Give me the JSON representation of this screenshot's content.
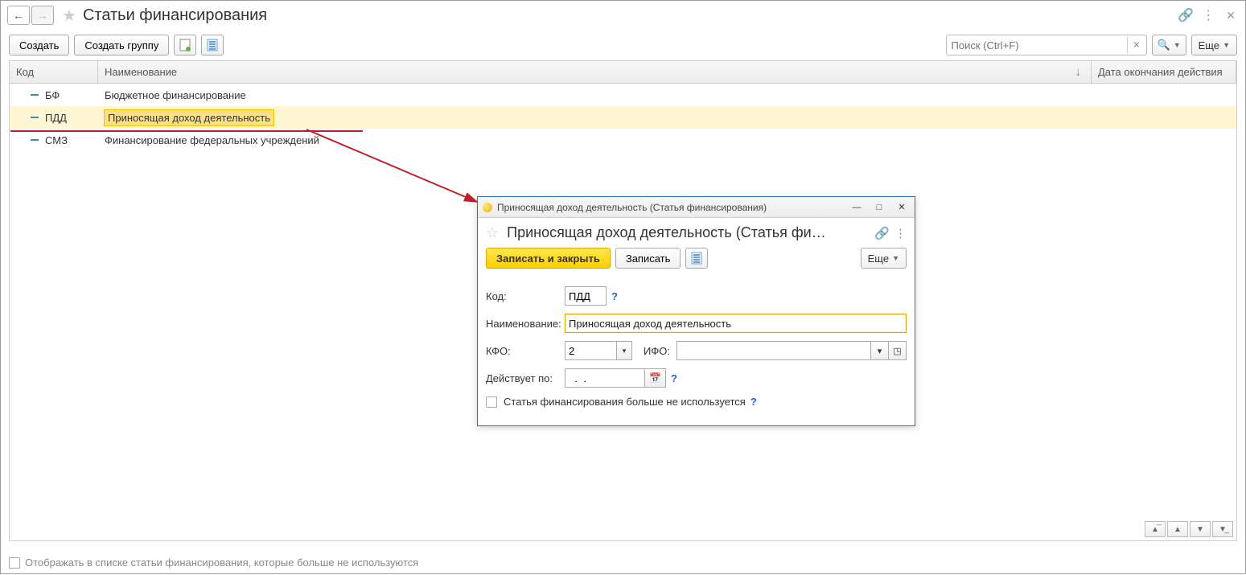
{
  "header": {
    "title": "Статьи финансирования"
  },
  "toolbar": {
    "create": "Создать",
    "create_group": "Создать группу",
    "search_placeholder": "Поиск (Ctrl+F)",
    "more": "Еще"
  },
  "grid": {
    "headers": {
      "code": "Код",
      "name": "Наименование",
      "end_date": "Дата окончания действия"
    },
    "rows": [
      {
        "code": "БФ",
        "name": "Бюджетное финансирование",
        "selected": false
      },
      {
        "code": "ПДД",
        "name": "Приносящая доход деятельность",
        "selected": true
      },
      {
        "code": "СМЗ",
        "name": "Финансирование федеральных учреждений",
        "selected": false
      }
    ]
  },
  "footer": {
    "show_unused": "Отображать в списке статьи финансирования, которые больше не используются"
  },
  "modal": {
    "titlebar": "Приносящая доход деятельность (Статья финансирования)",
    "title": "Приносящая доход деятельность (Статья фи…",
    "save_close": "Записать и закрыть",
    "save": "Записать",
    "more": "Еще",
    "labels": {
      "code": "Код:",
      "name": "Наименование:",
      "kfo": "КФО:",
      "ifo": "ИФО:",
      "valid_to": "Действует по:"
    },
    "values": {
      "code": "ПДД",
      "name": "Приносящая доход деятельность",
      "kfo": "2",
      "ifo": "",
      "valid_to": "  .  .    "
    },
    "unused_label": "Статья финансирования больше не используется"
  }
}
